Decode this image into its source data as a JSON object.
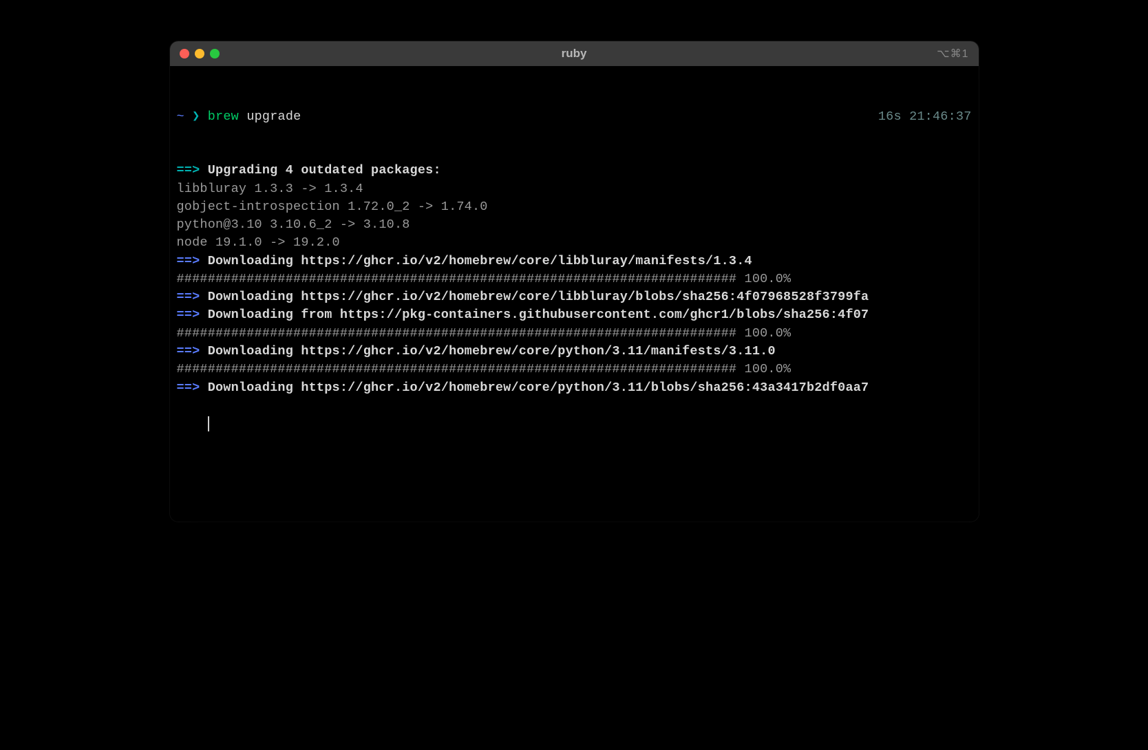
{
  "window": {
    "title": "ruby",
    "shortcut": "⌥⌘1"
  },
  "prompt": {
    "tilde": "~",
    "chevron": "❯",
    "command": "brew",
    "args": "upgrade",
    "duration": "16s",
    "time": "21:46:37"
  },
  "lines": [
    {
      "arrow": "==>",
      "arrowColor": "c-cyan",
      "text": " Upgrading 4 outdated packages:",
      "bold": true
    },
    {
      "plain": "libbluray 1.3.3 -> 1.3.4"
    },
    {
      "plain": "gobject-introspection 1.72.0_2 -> 1.74.0"
    },
    {
      "plain": "python@3.10 3.10.6_2 -> 3.10.8"
    },
    {
      "plain": "node 19.1.0 -> 19.2.0"
    },
    {
      "arrow": "==>",
      "arrowColor": "c-blue",
      "text": " Downloading https://ghcr.io/v2/homebrew/core/libbluray/manifests/1.3.4",
      "bold": true
    },
    {
      "plain": "######################################################################## 100.0%"
    },
    {
      "arrow": "==>",
      "arrowColor": "c-blue",
      "text": " Downloading https://ghcr.io/v2/homebrew/core/libbluray/blobs/sha256:4f07968528f3799fa",
      "bold": true
    },
    {
      "arrow": "==>",
      "arrowColor": "c-blue",
      "text": " Downloading from https://pkg-containers.githubusercontent.com/ghcr1/blobs/sha256:4f07",
      "bold": true
    },
    {
      "plain": "######################################################################## 100.0%"
    },
    {
      "arrow": "==>",
      "arrowColor": "c-blue",
      "text": " Downloading https://ghcr.io/v2/homebrew/core/python/3.11/manifests/3.11.0",
      "bold": true
    },
    {
      "plain": "######################################################################## 100.0%"
    },
    {
      "arrow": "==>",
      "arrowColor": "c-blue",
      "text": " Downloading https://ghcr.io/v2/homebrew/core/python/3.11/blobs/sha256:43a3417b2df0aa7",
      "bold": true
    }
  ]
}
